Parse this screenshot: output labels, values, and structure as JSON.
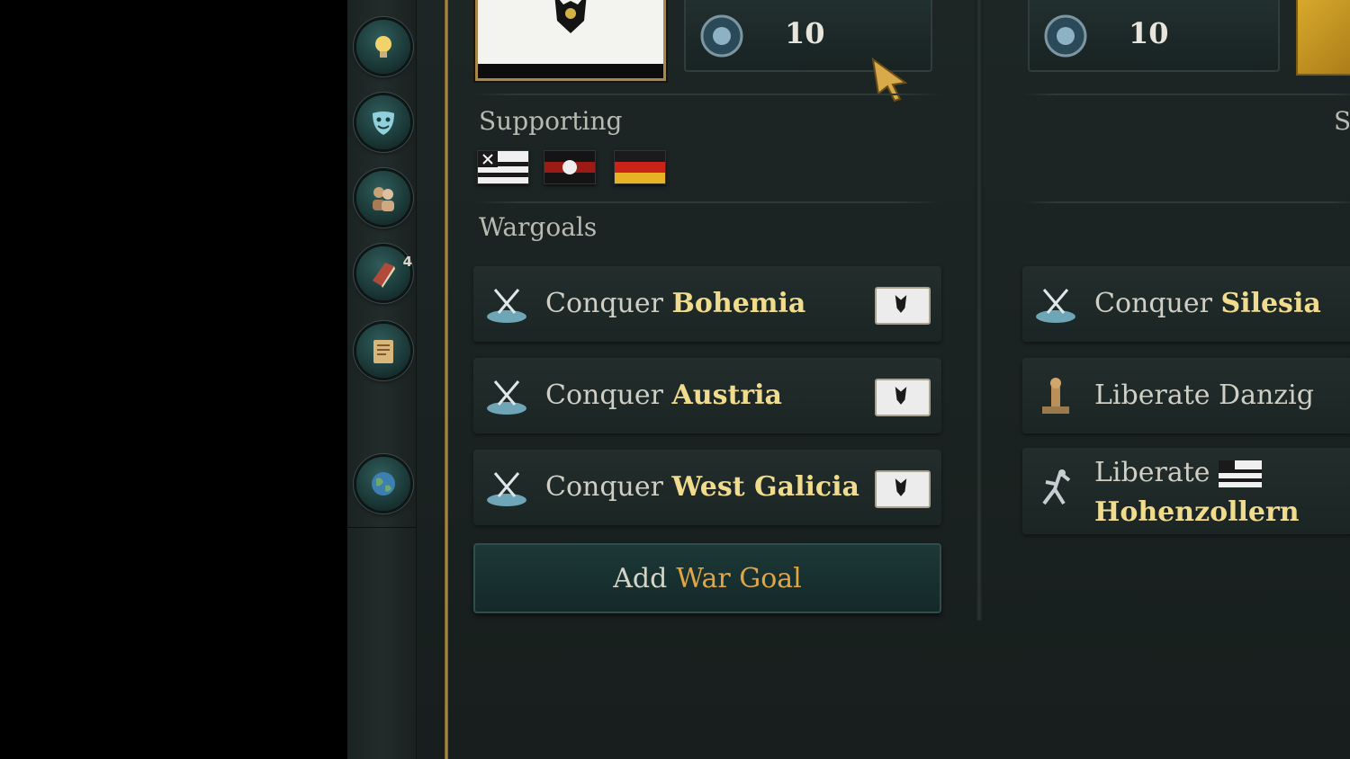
{
  "left_panel": {
    "buttons": [
      {
        "icon": "lightbulb-icon"
      },
      {
        "icon": "mask-icon"
      },
      {
        "icon": "people-icon"
      },
      {
        "icon": "book-icon",
        "badge": "4"
      },
      {
        "icon": "scroll-icon"
      },
      {
        "icon": "globe-icon"
      }
    ]
  },
  "left_side": {
    "score": "10",
    "supporting_title": "Supporting",
    "supporting_flags": [
      "hohenzollern-flag",
      "red-black-flag",
      "black-red-gold-flag"
    ],
    "wargoals_title": "Wargoals",
    "goals": [
      {
        "verb": "Conquer",
        "target": "Bohemia",
        "icon": "crossed-swords-icon"
      },
      {
        "verb": "Conquer",
        "target": "Austria",
        "icon": "crossed-swords-icon"
      },
      {
        "verb": "Conquer",
        "target": "West Galicia",
        "icon": "crossed-swords-icon"
      }
    ],
    "add_button": {
      "prefix": "Add",
      "highlight": "War Goal"
    }
  },
  "right_side": {
    "score": "10",
    "partial_title": "S",
    "goals": [
      {
        "verb": "Conquer",
        "target": "Silesia",
        "icon": "crossed-swords-icon"
      },
      {
        "verb": "Liberate Danzig",
        "target": "",
        "icon": "chess-pawn-icon"
      },
      {
        "verb": "Liberate",
        "target": "Hohenzollern",
        "icon": "freed-figure-icon"
      }
    ]
  },
  "colors": {
    "accent_gold": "#f0dc8c",
    "highlight_orange": "#e0a646",
    "panel": "#1d2625"
  }
}
